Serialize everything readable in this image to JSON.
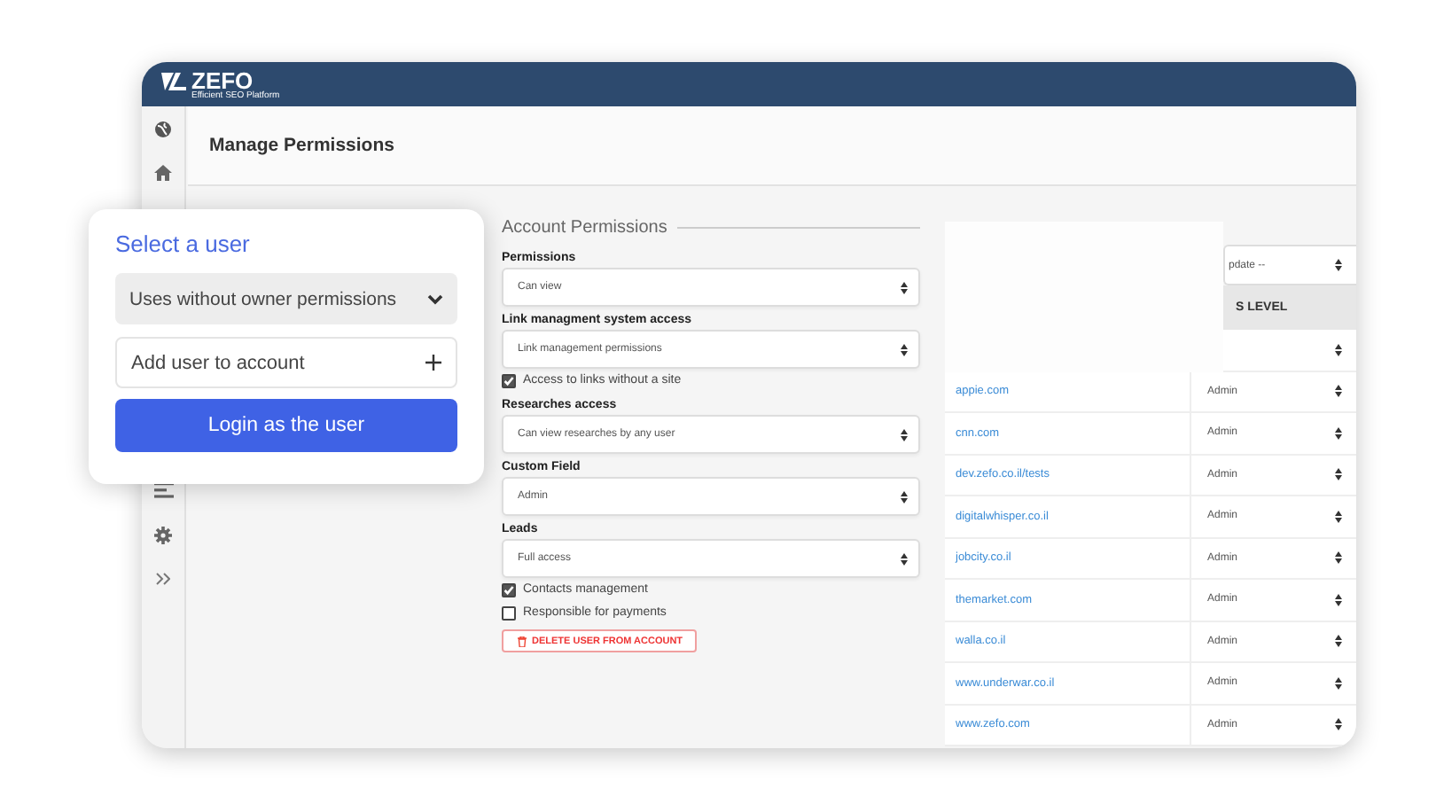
{
  "header": {
    "logo": "ZEFO",
    "tagline": "Efficient SEO Platform"
  },
  "page_title": "Manage Permissions",
  "popup": {
    "title": "Select a user",
    "dropdown": "Uses without owner permissions",
    "add_field": {
      "placeholder": "Add user to account"
    },
    "button": "Login as the user"
  },
  "account_permissions": {
    "title": "Account Permissions",
    "items": [
      {
        "kind": "label",
        "text": "Permissions"
      },
      {
        "kind": "select",
        "text": "Can view"
      },
      {
        "kind": "label",
        "text": "Link managment system access"
      },
      {
        "kind": "select",
        "text": "Link management permissions"
      },
      {
        "kind": "checkbox",
        "text": "Access to links without a site",
        "checked": true
      },
      {
        "kind": "label",
        "text": "Researches access"
      },
      {
        "kind": "select",
        "text": "Can view researches by any user"
      },
      {
        "kind": "label",
        "text": "Custom Field"
      },
      {
        "kind": "select",
        "text": "Admin"
      },
      {
        "kind": "label",
        "text": "Leads"
      },
      {
        "kind": "select",
        "text": "Full access"
      },
      {
        "kind": "checkbox",
        "text": "Contacts management",
        "checked": true
      },
      {
        "kind": "checkbox",
        "text": "Responsible for payments",
        "checked": false
      }
    ],
    "delete_button": "DELETE USER FROM ACCOUNT"
  },
  "website_table": {
    "update_select": "pdate --",
    "column_2": "S LEVEL",
    "rows": [
      {
        "kind": "covered"
      },
      {
        "kind": "site",
        "domain": "appie.com",
        "level": "Admin"
      },
      {
        "kind": "site",
        "domain": "cnn.com",
        "level": "Admin"
      },
      {
        "kind": "site",
        "domain": "dev.zefo.co.il/tests",
        "level": "Admin"
      },
      {
        "kind": "site",
        "domain": "digitalwhisper.co.il",
        "level": "Admin"
      },
      {
        "kind": "site",
        "domain": "jobcity.co.il",
        "level": "Admin"
      },
      {
        "kind": "site",
        "domain": "themarket.com",
        "level": "Admin"
      },
      {
        "kind": "site",
        "domain": "walla.co.il",
        "level": "Admin"
      },
      {
        "kind": "site",
        "domain": "www.underwar.co.il",
        "level": "Admin"
      },
      {
        "kind": "site",
        "domain": "www.zefo.com",
        "level": "Admin"
      }
    ]
  }
}
